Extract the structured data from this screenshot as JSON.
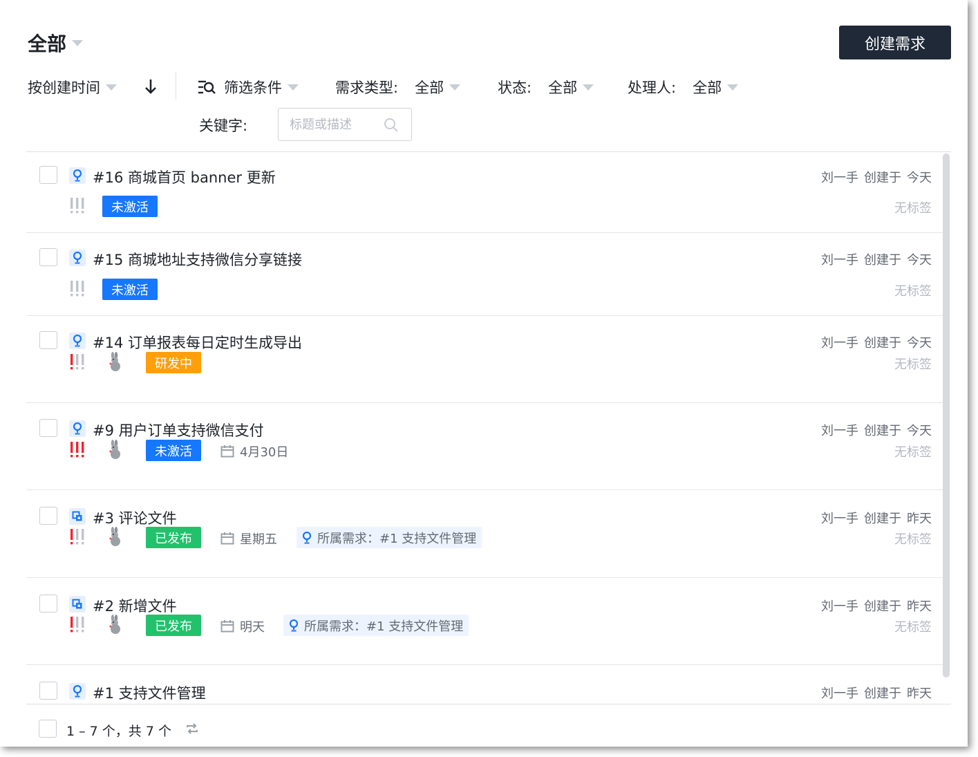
{
  "header": {
    "title": "全部",
    "create_button": "创建需求"
  },
  "toolbar": {
    "sort_label": "按创建时间",
    "filter_label": "筛选条件",
    "type_label": "需求类型:",
    "type_value": "全部",
    "status_label": "状态:",
    "status_value": "全部",
    "assignee_label": "处理人:",
    "assignee_value": "全部",
    "keyword_label": "关键字:",
    "keyword_placeholder": "标题或描述"
  },
  "colors": {
    "status_inactive": "#1677ff",
    "status_developing": "#ff9f0a",
    "status_released": "#21c26b",
    "priority_gray": "#bfc3c9",
    "priority_red": "#f5222d",
    "accent_dark": "#1f2937"
  },
  "rows": [
    {
      "title": "#16 商城首页 banner 更新",
      "type_icon": "lightbulb-icon",
      "creator": "刘一手",
      "created": "创建于",
      "when": "今天",
      "tags": "无标签",
      "priority": "low",
      "status": "未激活",
      "status_color": "#1677ff"
    },
    {
      "title": "#15 商城地址支持微信分享链接",
      "type_icon": "lightbulb-icon",
      "creator": "刘一手",
      "created": "创建于",
      "when": "今天",
      "tags": "无标签",
      "priority": "low",
      "status": "未激活",
      "status_color": "#1677ff"
    },
    {
      "title": "#14 订单报表每日定时生成导出",
      "type_icon": "lightbulb-icon",
      "creator": "刘一手",
      "created": "创建于",
      "when": "今天",
      "tags": "无标签",
      "priority": "medium",
      "status": "研发中",
      "status_color": "#ff9f0a"
    },
    {
      "title": "#9 用户订单支持微信支付",
      "type_icon": "lightbulb-icon",
      "creator": "刘一手",
      "created": "创建于",
      "when": "今天",
      "tags": "无标签",
      "priority": "high",
      "status": "未激活",
      "status_color": "#1677ff",
      "due": "4月30日"
    },
    {
      "title": "#3 评论文件",
      "type_icon": "subtask-icon",
      "creator": "刘一手",
      "created": "创建于",
      "when": "昨天",
      "tags": "无标签",
      "priority": "medium",
      "status": "已发布",
      "status_color": "#21c26b",
      "due": "星期五",
      "parent": "所属需求：#1 支持文件管理"
    },
    {
      "title": "#2 新增文件",
      "type_icon": "subtask-icon",
      "creator": "刘一手",
      "created": "创建于",
      "when": "昨天",
      "tags": "无标签",
      "priority": "medium",
      "status": "已发布",
      "status_color": "#21c26b",
      "due": "明天",
      "parent": "所属需求：#1 支持文件管理"
    },
    {
      "title": "#1 支持文件管理",
      "type_icon": "lightbulb-icon",
      "creator": "刘一手",
      "created": "创建于",
      "when": "昨天"
    }
  ],
  "footer": {
    "summary": "1 – 7 个，共 7 个"
  }
}
